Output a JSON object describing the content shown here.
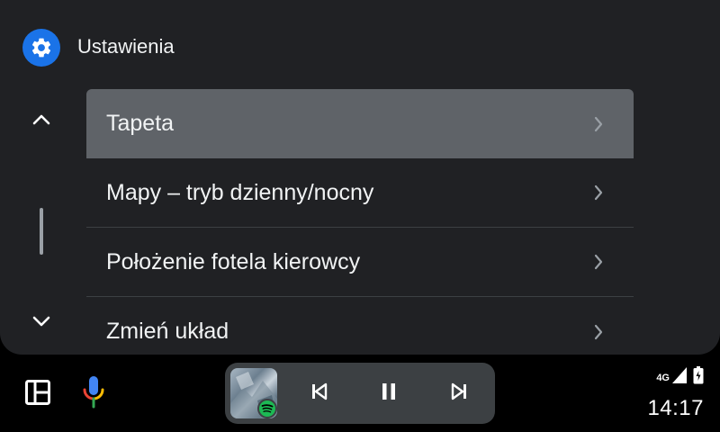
{
  "header": {
    "title": "Ustawienia",
    "icon": "gear-icon",
    "icon_bg": "#1a73e8"
  },
  "scroll": {
    "up_icon": "chevron-up-icon",
    "down_icon": "chevron-down-icon"
  },
  "settings": {
    "items": [
      {
        "label": "Tapeta",
        "selected": true
      },
      {
        "label": "Mapy – tryb dzienny/nocny",
        "selected": false
      },
      {
        "label": "Położenie fotela kierowcy",
        "selected": false
      },
      {
        "label": "Zmień układ",
        "selected": false
      }
    ]
  },
  "bottom_bar": {
    "layout_icon": "layout-grid-icon",
    "mic_icon": "microphone-icon",
    "media": {
      "app_icon": "spotify-icon",
      "prev_icon": "skip-previous-icon",
      "pause_icon": "pause-icon",
      "next_icon": "skip-next-icon"
    },
    "status": {
      "network": "4G",
      "clock": "14:17"
    }
  },
  "colors": {
    "card": "#202124",
    "selected": "#5f6368",
    "accent": "#1a73e8",
    "spotify": "#1db954"
  }
}
